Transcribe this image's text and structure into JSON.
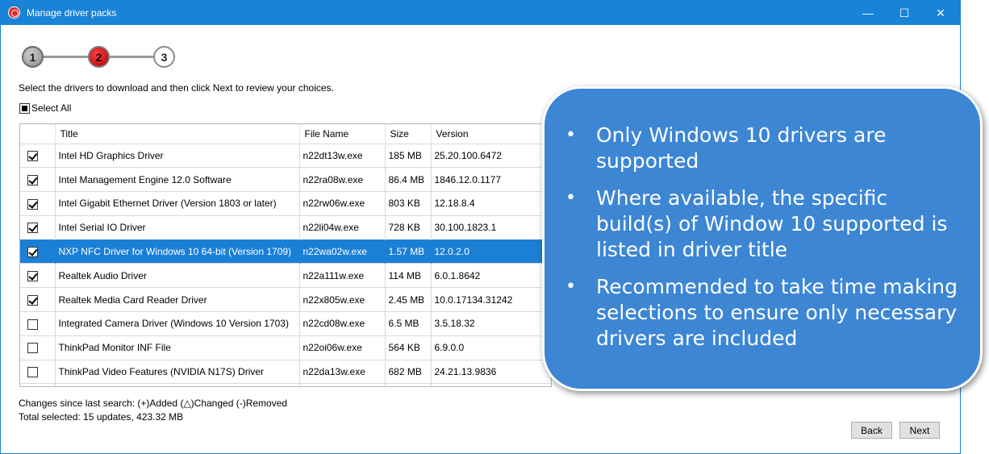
{
  "window": {
    "title": "Manage driver packs"
  },
  "steps": [
    "1",
    "2",
    "3"
  ],
  "instruction": "Select the drivers to download and then click Next to review your choices.",
  "select_all_label": "Select All",
  "table": {
    "columns": [
      "Title",
      "File Name",
      "Size",
      "Version"
    ],
    "rows": [
      {
        "checked": true,
        "title": "Intel HD Graphics Driver",
        "file": "n22dt13w.exe",
        "size": "185 MB",
        "version": "25.20.100.6472"
      },
      {
        "checked": true,
        "title": "Intel Management Engine 12.0 Software",
        "file": "n22ra08w.exe",
        "size": "86.4 MB",
        "version": "1846.12.0.1177"
      },
      {
        "checked": true,
        "title": "Intel Gigabit Ethernet Driver (Version 1803 or later)",
        "file": "n22rw06w.exe",
        "size": "803 KB",
        "version": "12.18.8.4"
      },
      {
        "checked": true,
        "title": "Intel Serial IO Driver",
        "file": "n22li04w.exe",
        "size": "728 KB",
        "version": "30.100.1823.1"
      },
      {
        "checked": true,
        "title": "NXP NFC Driver for Windows 10 64-bit (Version 1709)",
        "file": "n22wa02w.exe",
        "size": "1.57 MB",
        "version": "12.0.2.0",
        "selected": true
      },
      {
        "checked": true,
        "title": "Realtek Audio Driver",
        "file": "n22a111w.exe",
        "size": "114 MB",
        "version": "6.0.1.8642"
      },
      {
        "checked": true,
        "title": "Realtek Media Card Reader Driver",
        "file": "n22x805w.exe",
        "size": "2.45 MB",
        "version": "10.0.17134.31242"
      },
      {
        "checked": false,
        "title": "Integrated Camera Driver (Windows 10 Version 1703)",
        "file": "n22cd08w.exe",
        "size": "6.5 MB",
        "version": "3.5.18.32"
      },
      {
        "checked": false,
        "title": "ThinkPad Monitor INF File",
        "file": "n22oi06w.exe",
        "size": "564 KB",
        "version": "6.9.0.0"
      },
      {
        "checked": false,
        "title": "ThinkPad Video Features (NVIDIA N17S) Driver",
        "file": "n22da13w.exe",
        "size": "682 MB",
        "version": "24.21.13.9836"
      }
    ]
  },
  "changes_text": "Changes since last search: (+)Added  (△)Changed  (-)Removed",
  "total_text": "Total selected: 15 updates, 423.32 MB",
  "buttons": {
    "back": "Back",
    "next": "Next"
  },
  "callout": {
    "bullets": [
      "Only Windows 10 drivers are supported",
      "Where available, the specific build(s) of Window 10 supported is listed in driver title",
      "Recommended to take time making selections to ensure only necessary drivers are included"
    ]
  },
  "colors": {
    "titlebar": "#1883d7",
    "selection": "#1c7fd6",
    "callout": "#3c86d4",
    "active_step": "#e00000"
  }
}
